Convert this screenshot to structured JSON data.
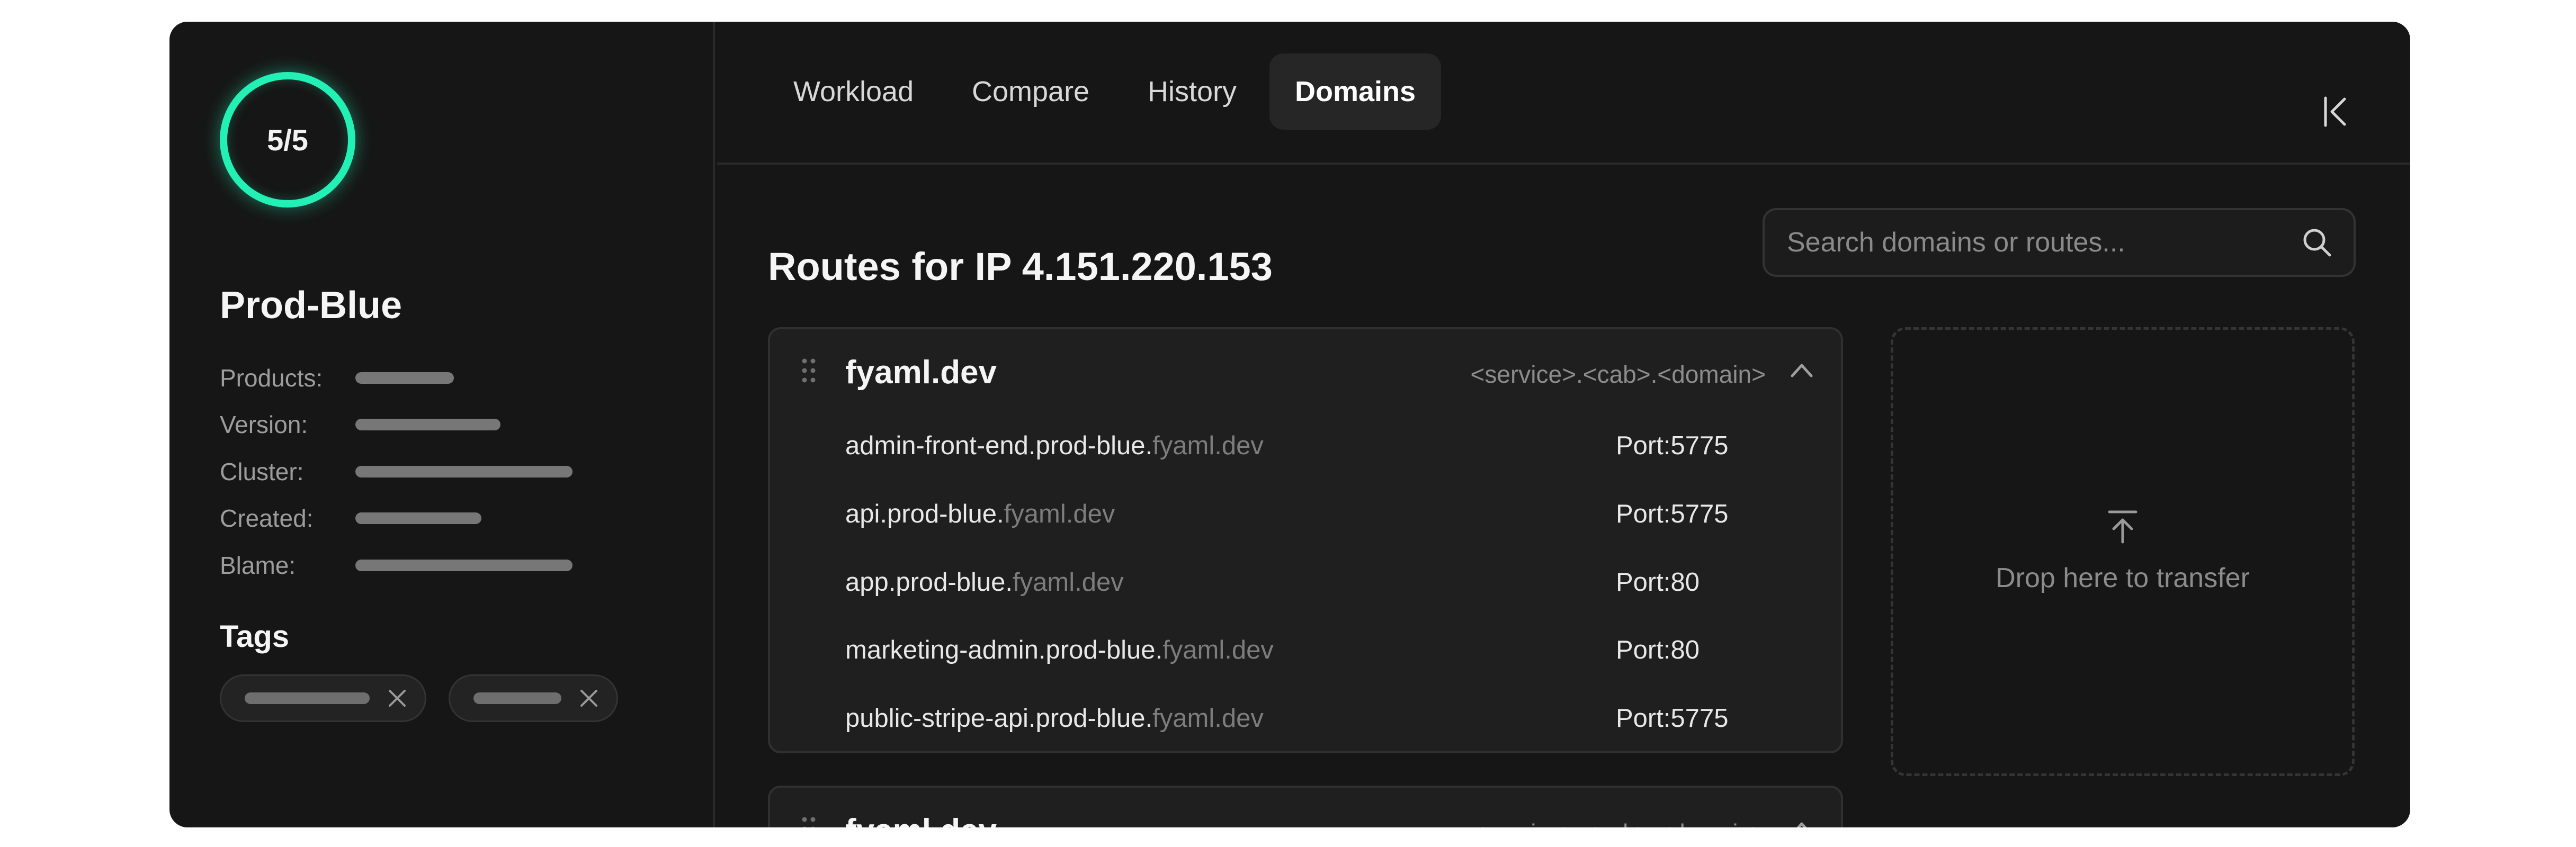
{
  "sidebar": {
    "progress_label": "5/5",
    "progress_fraction": 1.0,
    "env_name": "Prod-Blue",
    "meta": [
      {
        "label": "Products:"
      },
      {
        "label": "Version:"
      },
      {
        "label": "Cluster:"
      },
      {
        "label": "Created:"
      },
      {
        "label": "Blame:"
      }
    ],
    "tags_title": "Tags",
    "accent_color": "#23f0b4"
  },
  "tabs": [
    {
      "label": "Workload",
      "active": false
    },
    {
      "label": "Compare",
      "active": false
    },
    {
      "label": "History",
      "active": false
    },
    {
      "label": "Domains",
      "active": true
    }
  ],
  "main": {
    "title": "Routes for IP 4.151.220.153",
    "search_placeholder": "Search domains or routes...",
    "groups": [
      {
        "name": "fyaml.dev",
        "pattern": "<service>.<cab>.<domain>",
        "expanded": true,
        "routes": [
          {
            "prefix": "admin-front-end.prod-blue.",
            "domain": "fyaml.dev",
            "port": "Port:5775"
          },
          {
            "prefix": "api.prod-blue.",
            "domain": "fyaml.dev",
            "port": "Port:5775"
          },
          {
            "prefix": "app.prod-blue.",
            "domain": "fyaml.dev",
            "port": "Port:80"
          },
          {
            "prefix": "marketing-admin.prod-blue.",
            "domain": "fyaml.dev",
            "port": "Port:80"
          },
          {
            "prefix": "public-stripe-api.prod-blue.",
            "domain": "fyaml.dev",
            "port": "Port:5775"
          }
        ]
      },
      {
        "name": "fyaml.dev",
        "pattern": "<service>.<cab>.<domain>",
        "expanded": false,
        "routes": []
      }
    ],
    "dropzone_label": "Drop here to transfer"
  }
}
